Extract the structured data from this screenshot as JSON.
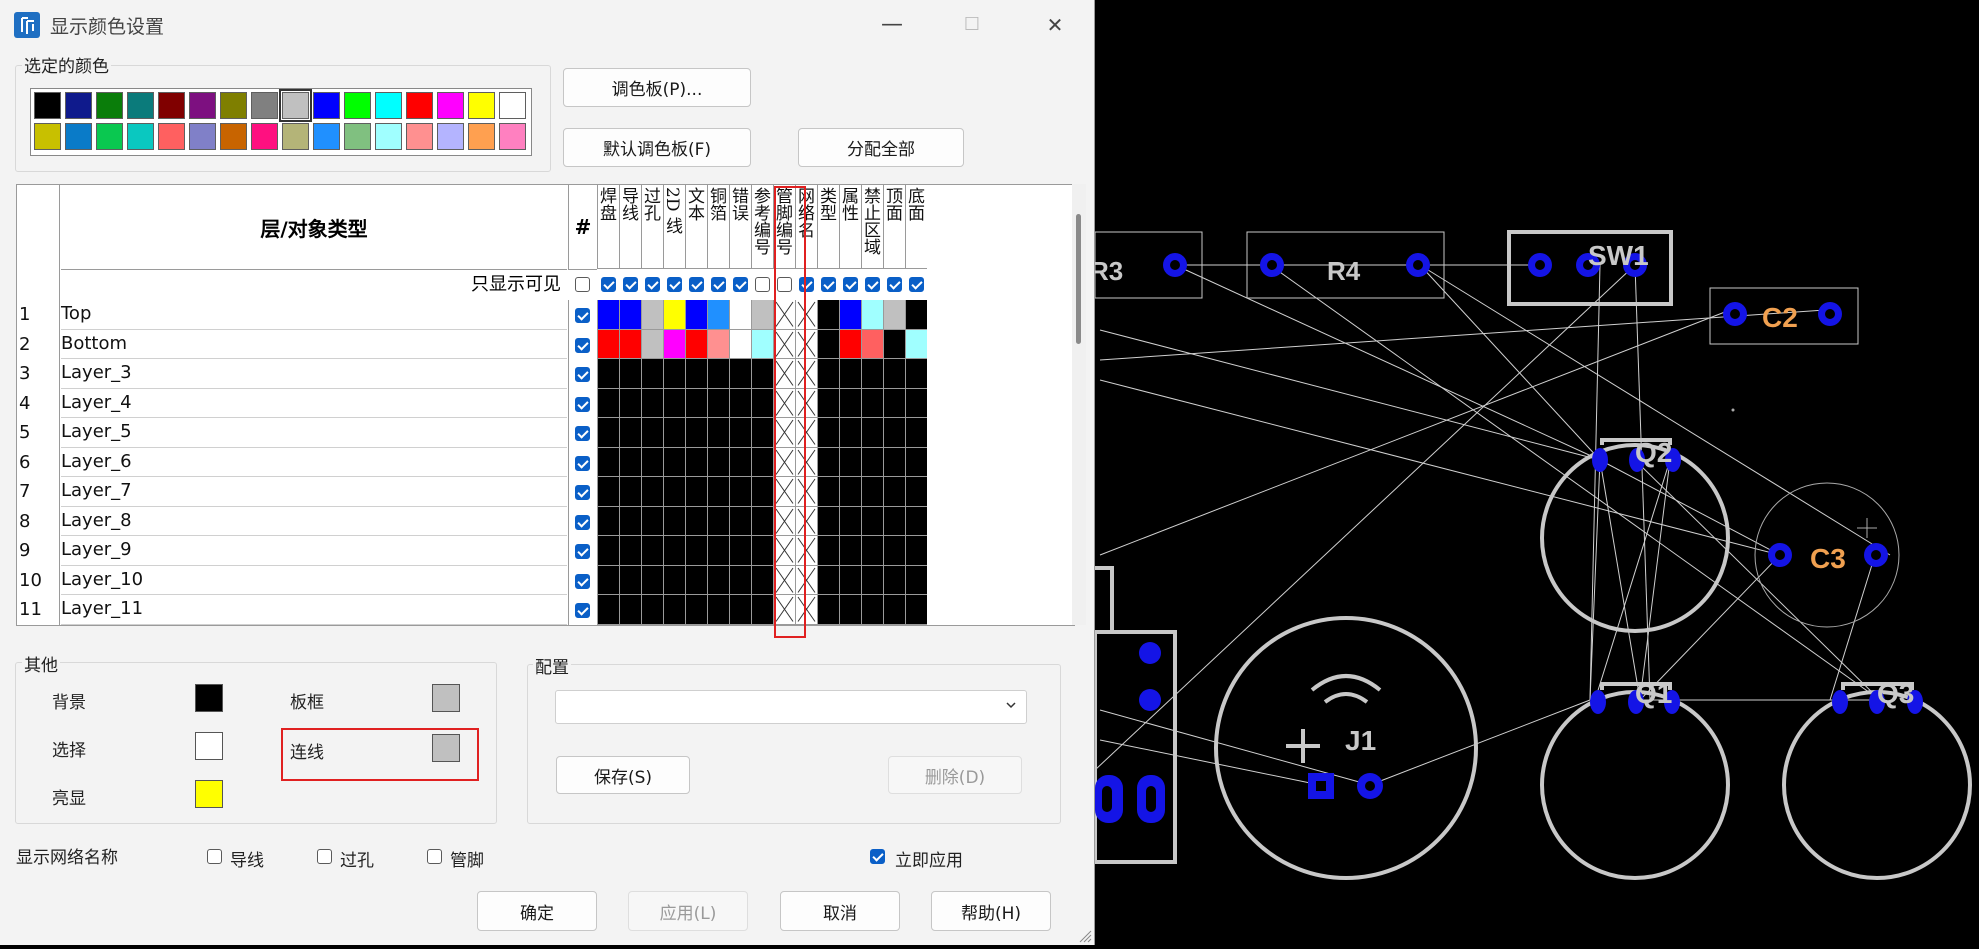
{
  "window": {
    "title": "显示颜色设置",
    "minimize": "—",
    "maximize": "☐",
    "close": "✕"
  },
  "palette": {
    "title": "选定的颜色",
    "row1": [
      "#000000",
      "#0f1a8c",
      "#0a7d0a",
      "#0b7b7b",
      "#800000",
      "#7d1080",
      "#7f7f00",
      "#808080",
      "#c0c0c0",
      "#0000ff",
      "#00ff00",
      "#00ffff",
      "#ff0000",
      "#ff00ff",
      "#ffff00",
      "#ffffff"
    ],
    "row2": [
      "#c8c000",
      "#0a7bc8",
      "#0ac850",
      "#0ac8c0",
      "#ff6060",
      "#8080c8",
      "#c86400",
      "#ff1080",
      "#b4b478",
      "#2090ff",
      "#80c080",
      "#a0ffff",
      "#ff9090",
      "#b4b4ff",
      "#ffa050",
      "#ff80c0"
    ],
    "selected_index": 8
  },
  "buttons": {
    "palette": "调色板(P)...",
    "default_palette": "默认调色板(F)",
    "assign_all": "分配全部",
    "save": "保存(S)",
    "delete": "删除(D)",
    "ok": "确定",
    "apply": "应用(L)",
    "cancel": "取消",
    "help": "帮助(H)"
  },
  "grid": {
    "header_title": "层/对象类型",
    "hash": "#",
    "columns": [
      "焊盘",
      "导线",
      "过孔",
      "2D 线",
      "文本",
      "铜箔",
      "错误",
      "参考编号",
      "管脚编号",
      "网络名",
      "类型",
      "属性",
      "禁止区域",
      "顶面",
      "底面"
    ],
    "visible_only_label": "只显示可见",
    "visible_only_checks": [
      false,
      true,
      true,
      true,
      true,
      true,
      true,
      true,
      false,
      false,
      true,
      true,
      true,
      true,
      true
    ],
    "rows": [
      {
        "num": "1",
        "name": "Top",
        "checked": true,
        "cells": [
          "#0000ff",
          "#0000ff",
          "#c0c0c0",
          "#ffff00",
          "#0000ff",
          "#2090ff",
          "#ffffff",
          "#c0c0c0",
          "X",
          "X",
          "#000000",
          "#0000ff",
          "#a0ffff",
          "#c0c0c0",
          "#000000"
        ]
      },
      {
        "num": "2",
        "name": "Bottom",
        "checked": true,
        "cells": [
          "#ff0000",
          "#ff0000",
          "#c0c0c0",
          "#ff00ff",
          "#ff0000",
          "#ff9090",
          "#ffffff",
          "#a0ffff",
          "X",
          "X",
          "#000000",
          "#ff0000",
          "#ff6060",
          "#000000",
          "#a0ffff"
        ]
      },
      {
        "num": "3",
        "name": "Layer_3",
        "checked": true,
        "cells": [
          "#000000",
          "#000000",
          "#000000",
          "#000000",
          "#000000",
          "#000000",
          "#000000",
          "#000000",
          "X",
          "X",
          "#000000",
          "#000000",
          "#000000",
          "#000000",
          "#000000"
        ]
      },
      {
        "num": "4",
        "name": "Layer_4",
        "checked": true,
        "cells": [
          "#000000",
          "#000000",
          "#000000",
          "#000000",
          "#000000",
          "#000000",
          "#000000",
          "#000000",
          "X",
          "X",
          "#000000",
          "#000000",
          "#000000",
          "#000000",
          "#000000"
        ]
      },
      {
        "num": "5",
        "name": "Layer_5",
        "checked": true,
        "cells": [
          "#000000",
          "#000000",
          "#000000",
          "#000000",
          "#000000",
          "#000000",
          "#000000",
          "#000000",
          "X",
          "X",
          "#000000",
          "#000000",
          "#000000",
          "#000000",
          "#000000"
        ]
      },
      {
        "num": "6",
        "name": "Layer_6",
        "checked": true,
        "cells": [
          "#000000",
          "#000000",
          "#000000",
          "#000000",
          "#000000",
          "#000000",
          "#000000",
          "#000000",
          "X",
          "X",
          "#000000",
          "#000000",
          "#000000",
          "#000000",
          "#000000"
        ]
      },
      {
        "num": "7",
        "name": "Layer_7",
        "checked": true,
        "cells": [
          "#000000",
          "#000000",
          "#000000",
          "#000000",
          "#000000",
          "#000000",
          "#000000",
          "#000000",
          "X",
          "X",
          "#000000",
          "#000000",
          "#000000",
          "#000000",
          "#000000"
        ]
      },
      {
        "num": "8",
        "name": "Layer_8",
        "checked": true,
        "cells": [
          "#000000",
          "#000000",
          "#000000",
          "#000000",
          "#000000",
          "#000000",
          "#000000",
          "#000000",
          "X",
          "X",
          "#000000",
          "#000000",
          "#000000",
          "#000000",
          "#000000"
        ]
      },
      {
        "num": "9",
        "name": "Layer_9",
        "checked": true,
        "cells": [
          "#000000",
          "#000000",
          "#000000",
          "#000000",
          "#000000",
          "#000000",
          "#000000",
          "#000000",
          "X",
          "X",
          "#000000",
          "#000000",
          "#000000",
          "#000000",
          "#000000"
        ]
      },
      {
        "num": "10",
        "name": "Layer_10",
        "checked": true,
        "cells": [
          "#000000",
          "#000000",
          "#000000",
          "#000000",
          "#000000",
          "#000000",
          "#000000",
          "#000000",
          "X",
          "X",
          "#000000",
          "#000000",
          "#000000",
          "#000000",
          "#000000"
        ]
      },
      {
        "num": "11",
        "name": "Layer_11",
        "checked": true,
        "cells": [
          "#000000",
          "#000000",
          "#000000",
          "#000000",
          "#000000",
          "#000000",
          "#000000",
          "#000000",
          "X",
          "X",
          "#000000",
          "#000000",
          "#000000",
          "#000000",
          "#000000"
        ]
      }
    ]
  },
  "other": {
    "title": "其他",
    "background": {
      "label": "背景",
      "color": "#000000"
    },
    "selection": {
      "label": "选择",
      "color": "#ffffff"
    },
    "highlight": {
      "label": "亮显",
      "color": "#ffff00"
    },
    "board_outline": {
      "label": "板框",
      "color": "#c0c0c0"
    },
    "connection": {
      "label": "连线",
      "color": "#c0c0c0"
    }
  },
  "config": {
    "title": "配置",
    "value": ""
  },
  "net_names": {
    "label": "显示网络名称",
    "trace": {
      "label": "导线",
      "checked": false
    },
    "via": {
      "label": "过孔",
      "checked": false
    },
    "pin": {
      "label": "管脚",
      "checked": false
    }
  },
  "apply_now": {
    "label": "立即应用",
    "checked": true
  },
  "pcb": {
    "labels": [
      "R3",
      "R4",
      "SW1",
      "C2",
      "Q2",
      "C3",
      "Q1",
      "Q3",
      "J1"
    ],
    "pad_color": "#1414e6",
    "outline_color": "#c8c8c8",
    "ref_color": "#c8c8c8",
    "cap_label_color": "#f0a050"
  }
}
